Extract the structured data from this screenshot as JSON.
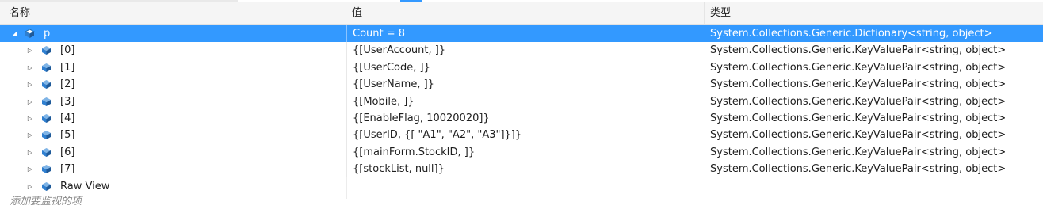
{
  "columns": {
    "name": "名称",
    "value": "值",
    "type": "类型"
  },
  "root": {
    "name": "p",
    "value": "Count = 8",
    "type": "System.Collections.Generic.Dictionary<string, object>",
    "expanded_glyph": "◢",
    "icon": "object-icon"
  },
  "children": [
    {
      "name": "[0]",
      "value": "{[UserAccount, ]}",
      "type": "System.Collections.Generic.KeyValuePair<string, object>"
    },
    {
      "name": "[1]",
      "value": "{[UserCode, ]}",
      "type": "System.Collections.Generic.KeyValuePair<string, object>"
    },
    {
      "name": "[2]",
      "value": "{[UserName, ]}",
      "type": "System.Collections.Generic.KeyValuePair<string, object>"
    },
    {
      "name": "[3]",
      "value": "{[Mobile, ]}",
      "type": "System.Collections.Generic.KeyValuePair<string, object>"
    },
    {
      "name": "[4]",
      "value": "{[EnableFlag, 10020020]}",
      "type": "System.Collections.Generic.KeyValuePair<string, object>"
    },
    {
      "name": "[5]",
      "value": "{[UserID, {[  \"A1\",  \"A2\",  \"A3\"]}]}",
      "type": "System.Collections.Generic.KeyValuePair<string, object>"
    },
    {
      "name": "[6]",
      "value": "{[mainForm.StockID, ]}",
      "type": "System.Collections.Generic.KeyValuePair<string, object>"
    },
    {
      "name": "[7]",
      "value": "{[stockList, null]}",
      "type": "System.Collections.Generic.KeyValuePair<string, object>"
    }
  ],
  "raw_view": {
    "name": "Raw View"
  },
  "collapsed_glyph": "▷",
  "add_watch_placeholder": "添加要监视的项",
  "colors": {
    "selection": "#3399ff",
    "icon": "#1f6fb5",
    "header_bg": "#f5f5f5"
  }
}
